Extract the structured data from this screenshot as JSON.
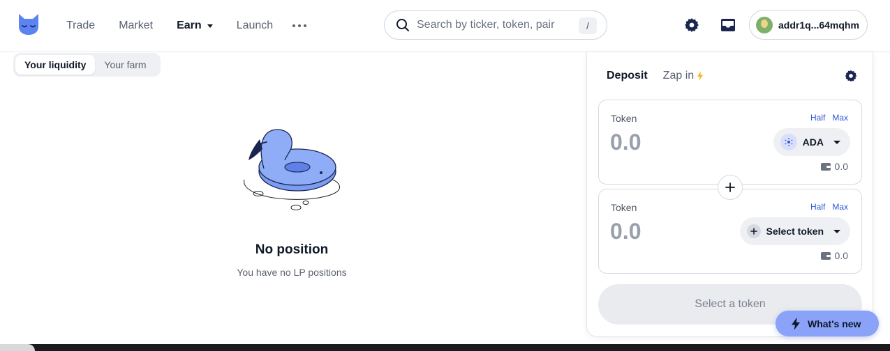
{
  "header": {
    "nav": [
      {
        "label": "Trade"
      },
      {
        "label": "Market"
      },
      {
        "label": "Earn"
      },
      {
        "label": "Launch"
      }
    ],
    "search": {
      "placeholder": "Search by ticker, token, pair",
      "shortcut": "/"
    },
    "wallet": {
      "address": "addr1q...64mqhm"
    }
  },
  "liquidity_tabs": [
    "Your liquidity",
    "Your farm"
  ],
  "empty_state": {
    "title": "No position",
    "subtitle": "You have no LP positions"
  },
  "panel": {
    "tabs": [
      "Deposit",
      "Zap in"
    ],
    "token1": {
      "label": "Token",
      "half": "Half",
      "max": "Max",
      "amount_placeholder": "0.0",
      "token": "ADA",
      "balance": "0.0"
    },
    "token2": {
      "label": "Token",
      "half": "Half",
      "max": "Max",
      "amount_placeholder": "0.0",
      "token": "Select token",
      "balance": "0.0"
    },
    "cta": "Select a token"
  },
  "whats_new": "What's new",
  "colors": {
    "accent": "#2f56d8",
    "whats_new_bg": "#8aa2f7",
    "flamingo": "#7b9cf2",
    "bolt": "#f5b721"
  }
}
